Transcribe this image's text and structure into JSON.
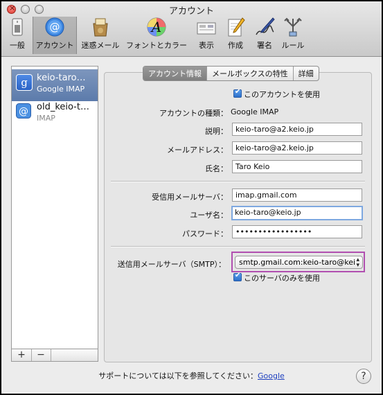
{
  "window": {
    "title": "アカウント"
  },
  "toolbar": [
    {
      "key": "general",
      "label": "一般",
      "icon": "switch-icon"
    },
    {
      "key": "accounts",
      "label": "アカウント",
      "icon": "at-icon",
      "selected": true
    },
    {
      "key": "junk",
      "label": "迷惑メール",
      "icon": "junk-mail-icon"
    },
    {
      "key": "fonts",
      "label": "フォントとカラー",
      "icon": "fonts-colors-icon"
    },
    {
      "key": "viewing",
      "label": "表示",
      "icon": "viewing-icon"
    },
    {
      "key": "composing",
      "label": "作成",
      "icon": "composing-icon"
    },
    {
      "key": "signatures",
      "label": "署名",
      "icon": "signature-icon"
    },
    {
      "key": "rules",
      "label": "ルール",
      "icon": "rules-icon"
    }
  ],
  "accounts": [
    {
      "name": "keio-taro…",
      "type": "Google IMAP",
      "icon": "google-icon",
      "selected": true
    },
    {
      "name": "old_keio-t…",
      "type": "IMAP",
      "icon": "at-icon",
      "selected": false
    }
  ],
  "account_buttons": {
    "add": "+",
    "remove": "−"
  },
  "tabs": [
    "アカウント情報",
    "メールボックスの特性",
    "詳細"
  ],
  "form": {
    "enable_account": "このアカウントを使用",
    "account_type_label": "アカウントの種類：",
    "account_type_value": "Google IMAP",
    "description_label": "説明：",
    "description_value": "keio-taro@a2.keio.jp",
    "email_label": "メールアドレス：",
    "email_value": "keio-taro@a2.keio.jp",
    "fullname_label": "氏名：",
    "fullname_value": "Taro Keio",
    "incoming_label": "受信用メールサーバ：",
    "incoming_value": "imap.gmail.com",
    "username_label": "ユーザ名：",
    "username_value": "keio-taro@keio.jp",
    "password_label": "パスワード：",
    "password_value": "•••••••••••••••••",
    "smtp_label": "送信用メールサーバ（SMTP）：",
    "smtp_value": "smtp.gmail.com:keio-taro@kei",
    "smtp_only": "このサーバのみを使用"
  },
  "footer": {
    "support_text": "サポートについては以下を参照してください：",
    "support_link": "Google",
    "help": "?"
  },
  "colors": {
    "highlight": "#b14fb0",
    "selection": "#5c7bab",
    "link": "#1d3fbf"
  }
}
